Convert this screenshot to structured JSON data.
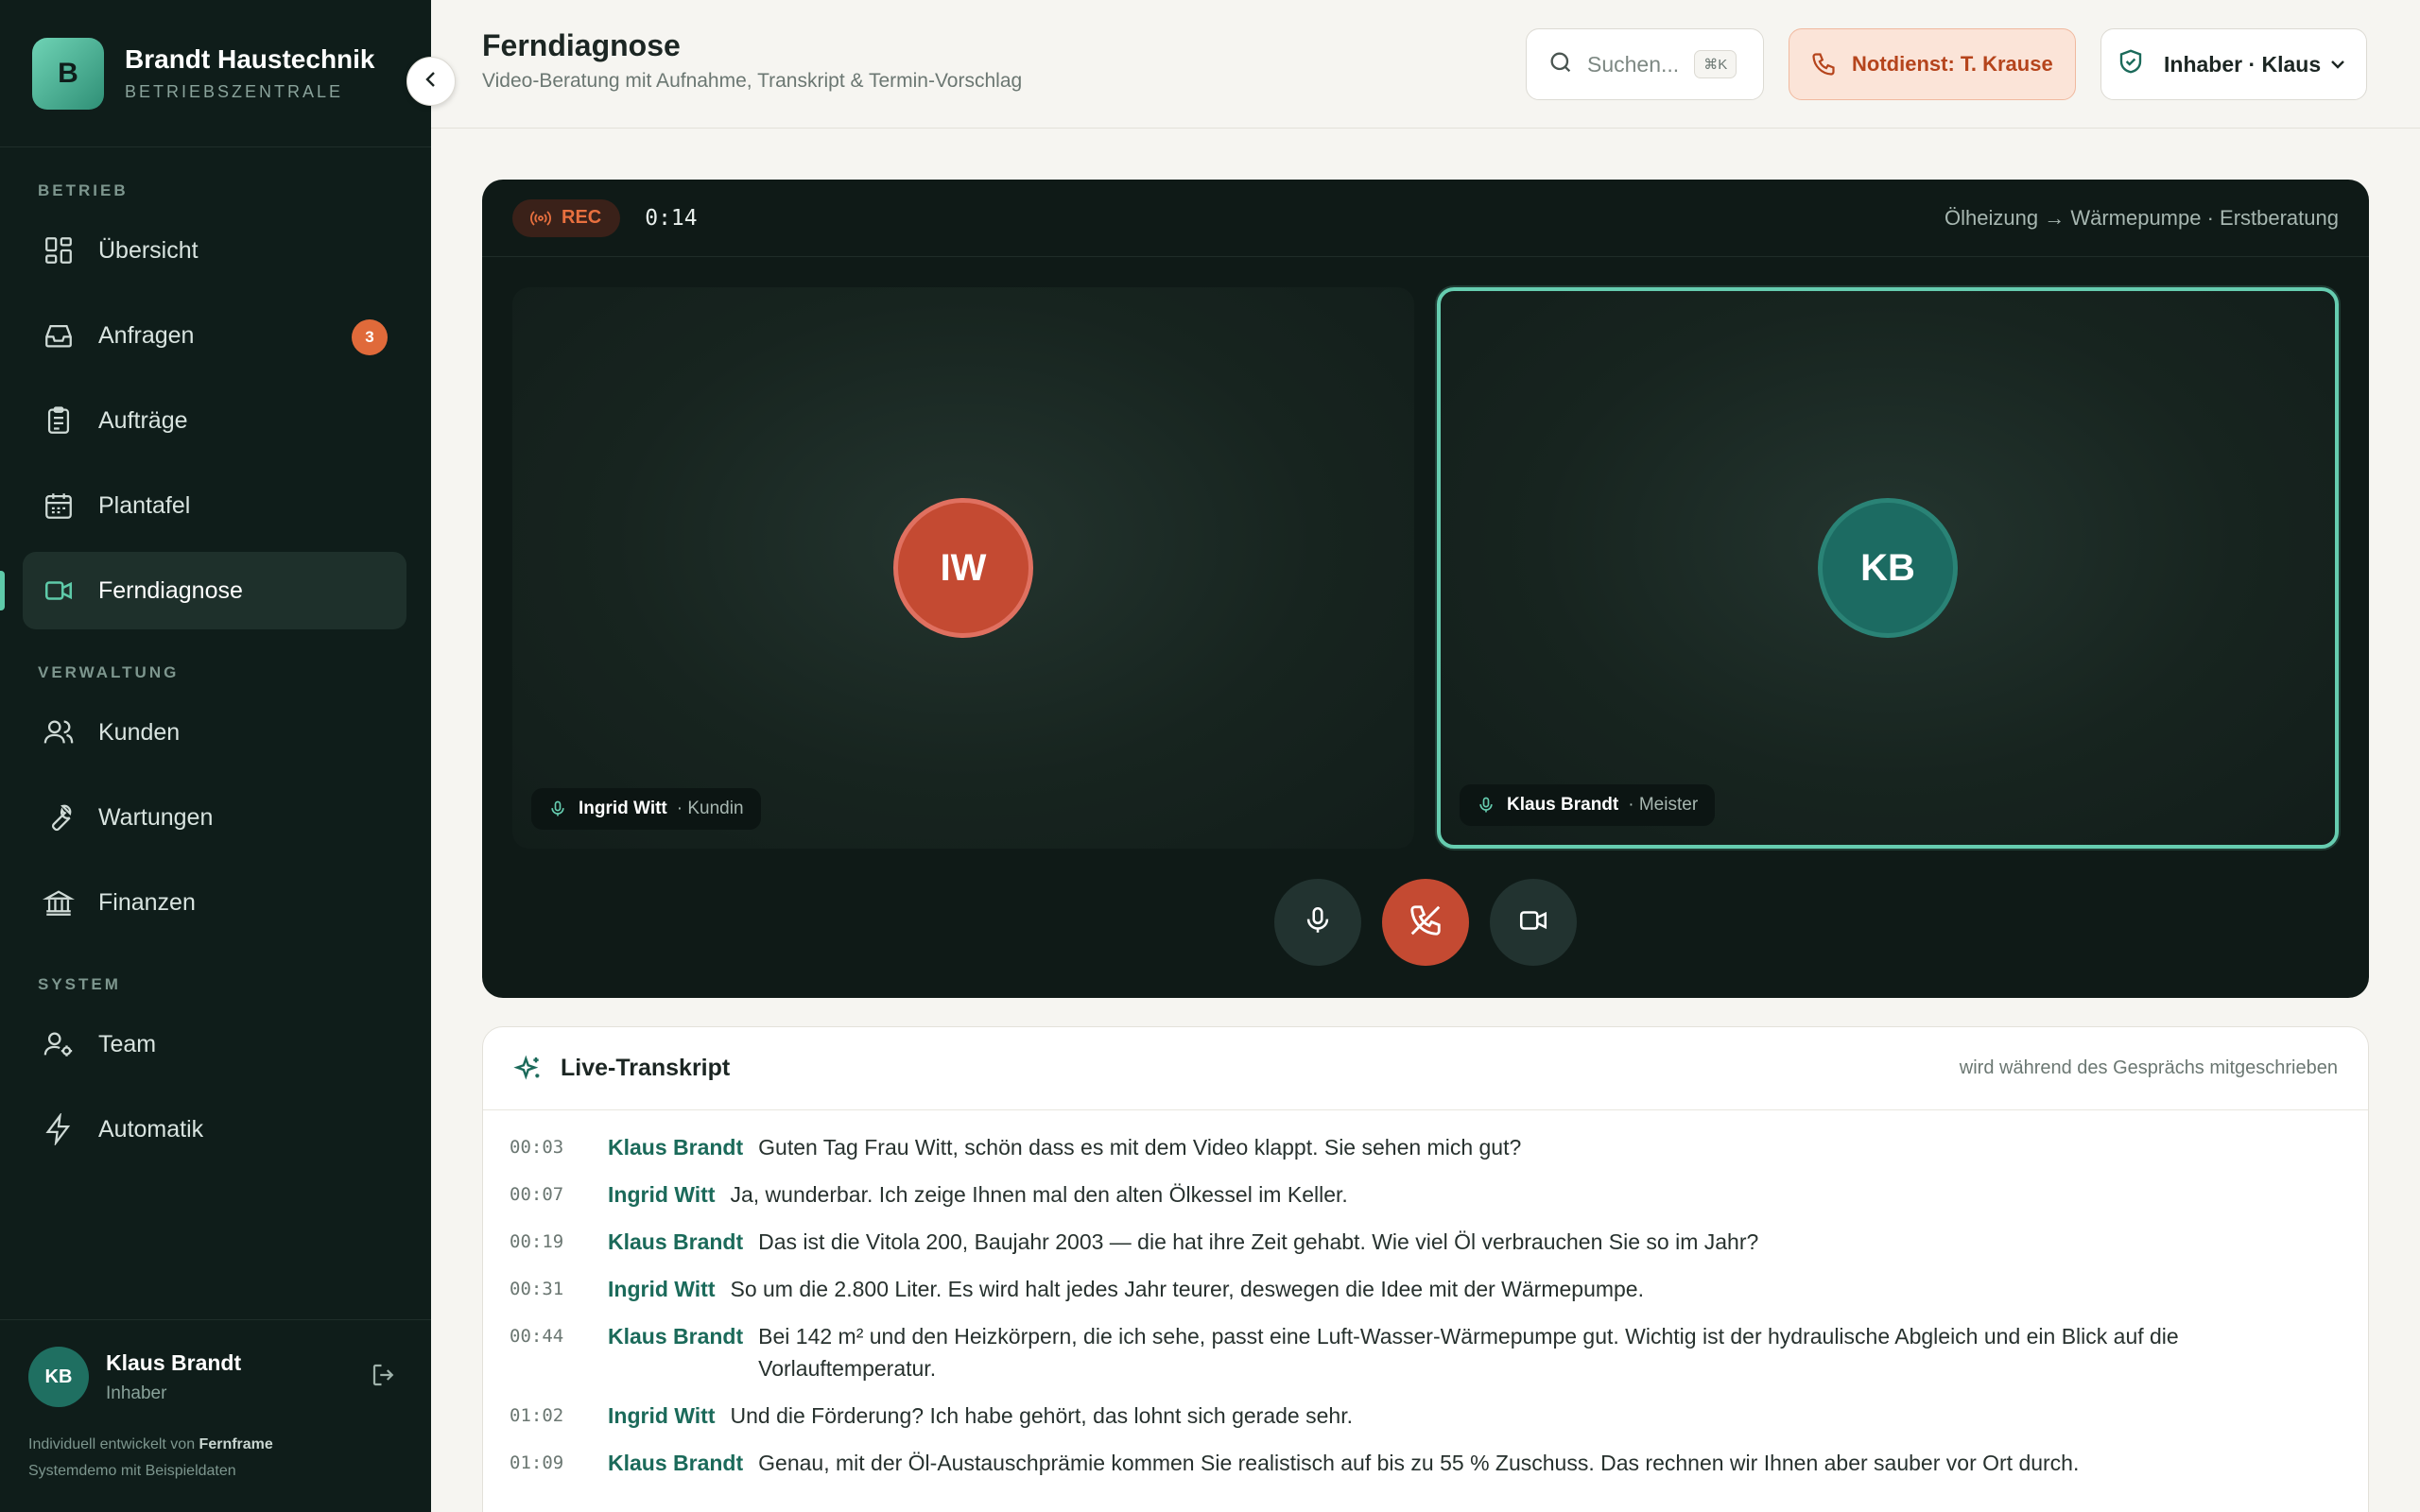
{
  "brand": {
    "logo_letter": "B",
    "name": "Brandt Haustechnik",
    "subtitle": "BETRIEBSZENTRALE"
  },
  "sidebar": {
    "sections": [
      {
        "label": "BETRIEB"
      },
      {
        "label": "VERWALTUNG"
      },
      {
        "label": "SYSTEM"
      }
    ],
    "items": [
      {
        "label": "Übersicht",
        "icon": "grid-icon"
      },
      {
        "label": "Anfragen",
        "icon": "inbox-icon",
        "badge": "3"
      },
      {
        "label": "Aufträge",
        "icon": "clipboard-icon"
      },
      {
        "label": "Plantafel",
        "icon": "calendar-icon"
      },
      {
        "label": "Ferndiagnose",
        "icon": "video-icon",
        "active": true
      },
      {
        "label": "Kunden",
        "icon": "users-icon"
      },
      {
        "label": "Wartungen",
        "icon": "wrench-icon"
      },
      {
        "label": "Finanzen",
        "icon": "bank-icon"
      },
      {
        "label": "Team",
        "icon": "user-gear-icon"
      },
      {
        "label": "Automatik",
        "icon": "lightning-icon"
      }
    ],
    "user": {
      "initials": "KB",
      "name": "Klaus Brandt",
      "role": "Inhaber"
    },
    "credits": {
      "prefix": "Individuell entwickelt von",
      "company": "Fernframe",
      "line2": "Systemdemo mit Beispieldaten"
    }
  },
  "header": {
    "title": "Ferndiagnose",
    "subtitle": "Video-Beratung mit Aufnahme, Transkript & Termin-Vorschlag",
    "search_placeholder": "Suchen...",
    "search_shortcut": "⌘K",
    "emergency": "Notdienst: T. Krause",
    "owner": "Inhaber · Klaus"
  },
  "call": {
    "rec_label": "REC",
    "timer": "0:14",
    "topic": "Ölheizung → Wärmepumpe · Erstberatung",
    "participants": [
      {
        "initials": "IW",
        "name": "Ingrid Witt",
        "role": "· Kundin"
      },
      {
        "initials": "KB",
        "name": "Klaus Brandt",
        "role": "· Meister"
      }
    ]
  },
  "transcript": {
    "title": "Live-Transkript",
    "note": "wird während des Gesprächs mitgeschrieben",
    "rows": [
      {
        "time": "00:03",
        "speaker": "Klaus Brandt",
        "text": "Guten Tag Frau Witt, schön dass es mit dem Video klappt. Sie sehen mich gut?"
      },
      {
        "time": "00:07",
        "speaker": "Ingrid Witt",
        "text": "Ja, wunderbar. Ich zeige Ihnen mal den alten Ölkessel im Keller."
      },
      {
        "time": "00:19",
        "speaker": "Klaus Brandt",
        "text": "Das ist die Vitola 200, Baujahr 2003 — die hat ihre Zeit gehabt. Wie viel Öl verbrauchen Sie so im Jahr?"
      },
      {
        "time": "00:31",
        "speaker": "Ingrid Witt",
        "text": "So um die 2.800 Liter. Es wird halt jedes Jahr teurer, deswegen die Idee mit der Wärmepumpe."
      },
      {
        "time": "00:44",
        "speaker": "Klaus Brandt",
        "text": "Bei 142 m² und den Heizkörpern, die ich sehe, passt eine Luft-Wasser-Wärmepumpe gut. Wichtig ist der hydraulische Abgleich und ein Blick auf die Vorlauftemperatur."
      },
      {
        "time": "01:02",
        "speaker": "Ingrid Witt",
        "text": "Und die Förderung? Ich habe gehört, das lohnt sich gerade sehr."
      },
      {
        "time": "01:09",
        "speaker": "Klaus Brandt",
        "text": "Genau, mit der Öl-Austauschprämie kommen Sie realistisch auf bis zu 55 % Zuschuss. Das rechnen wir Ihnen aber sauber vor Ort durch."
      }
    ]
  }
}
